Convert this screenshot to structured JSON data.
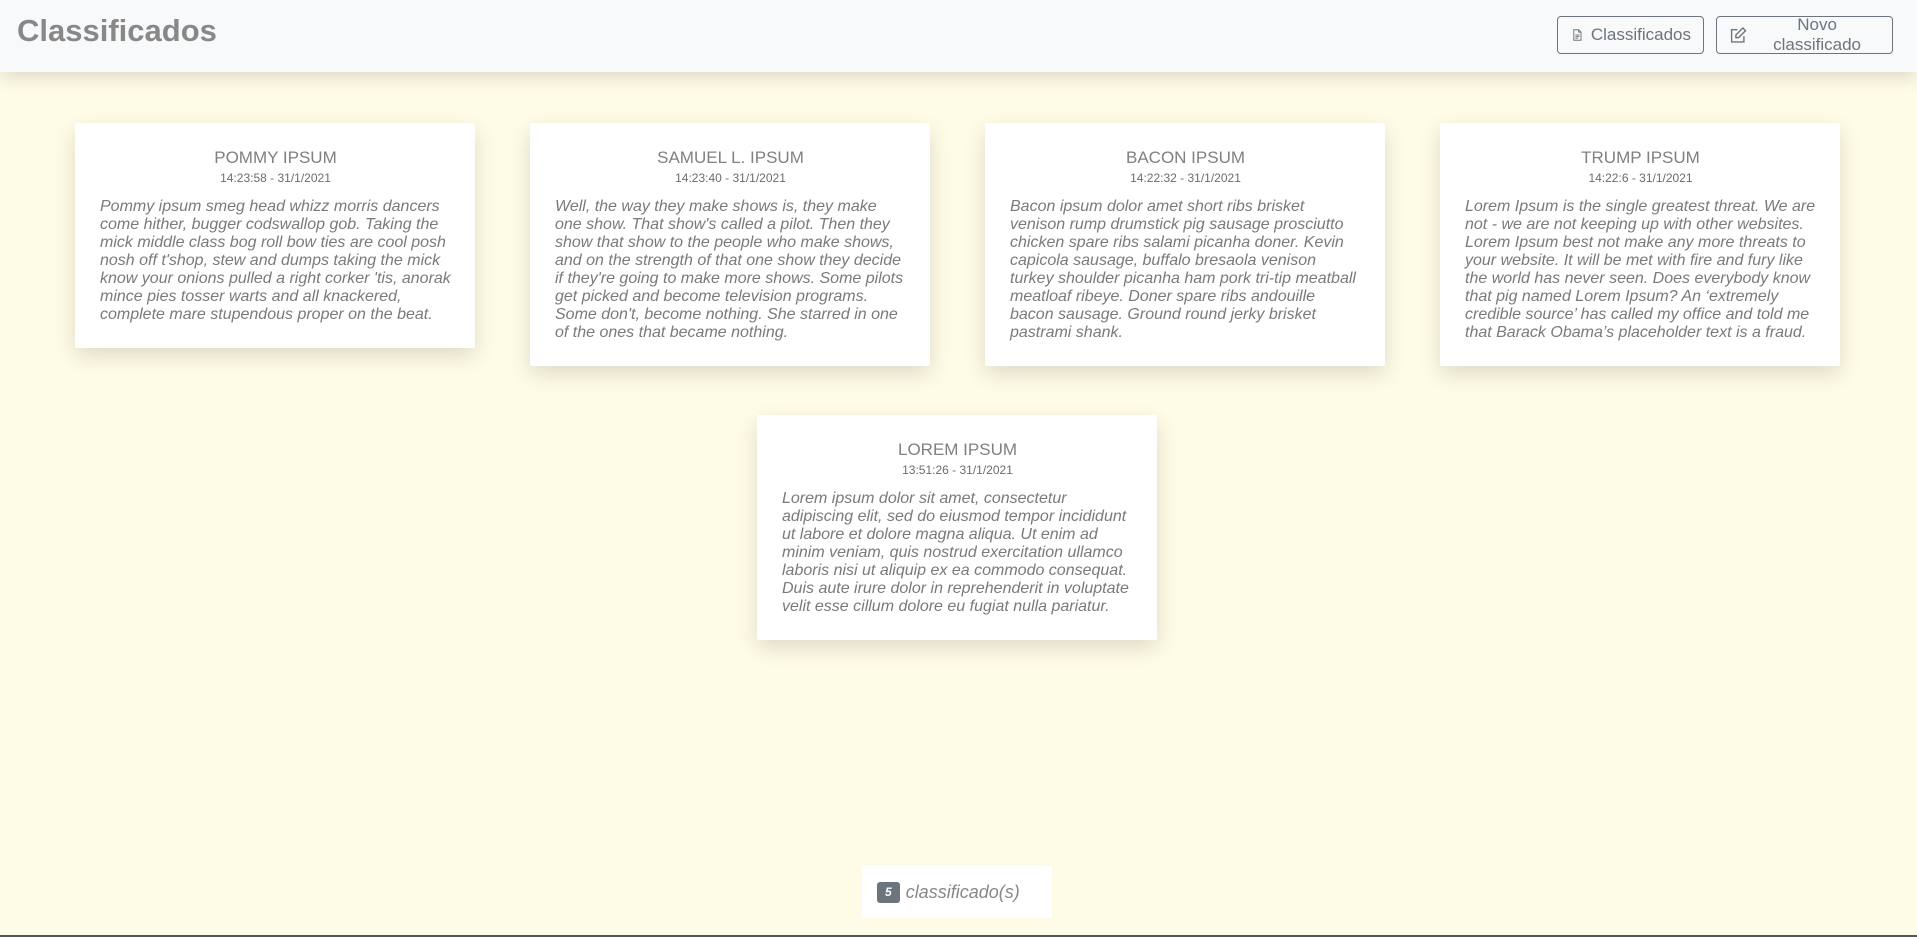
{
  "app": {
    "brand": "Classificados"
  },
  "nav": {
    "list_label": "Classificados",
    "new_label": "Novo classificado"
  },
  "cards": [
    {
      "title": "POMMY IPSUM",
      "time": "14:23:58 - 31/1/2021",
      "text": "Pommy ipsum smeg head whizz morris dancers come hither, bugger codswallop gob. Taking the mick middle class bog roll bow ties are cool posh nosh off t'shop, stew and dumps taking the mick know your onions pulled a right corker 'tis, anorak mince pies tosser warts and all knackered, complete mare stupendous proper on the beat."
    },
    {
      "title": "SAMUEL L. IPSUM",
      "time": "14:23:40 - 31/1/2021",
      "text": "Well, the way they make shows is, they make one show. That show's called a pilot. Then they show that show to the people who make shows, and on the strength of that one show they decide if they're going to make more shows. Some pilots get picked and become television programs. Some don't, become nothing. She starred in one of the ones that became nothing."
    },
    {
      "title": "BACON IPSUM",
      "time": "14:22:32 - 31/1/2021",
      "text": "Bacon ipsum dolor amet short ribs brisket venison rump drumstick pig sausage prosciutto chicken spare ribs salami picanha doner. Kevin capicola sausage, buffalo bresaola venison turkey shoulder picanha ham pork tri-tip meatball meatloaf ribeye. Doner spare ribs andouille bacon sausage. Ground round jerky brisket pastrami shank."
    },
    {
      "title": "TRUMP IPSUM",
      "time": "14:22:6 - 31/1/2021",
      "text": "Lorem Ipsum is the single greatest threat. We are not - we are not keeping up with other websites. Lorem Ipsum best not make any more threats to your website. It will be met with fire and fury like the world has never seen. Does everybody know that pig named Lorem Ipsum? An ‘extremely credible source’ has called my office and told me that Barack Obama’s placeholder text is a fraud."
    },
    {
      "title": "LOREM IPSUM",
      "time": "13:51:26 - 31/1/2021",
      "text": "Lorem ipsum dolor sit amet, consectetur adipiscing elit, sed do eiusmod tempor incididunt ut labore et dolore magna aliqua. Ut enim ad minim veniam, quis nostrud exercitation ullamco laboris nisi ut aliquip ex ea commodo consequat. Duis aute irure dolor in reprehenderit in voluptate velit esse cillum dolore eu fugiat nulla pariatur."
    }
  ],
  "footer": {
    "count": "5",
    "count_label": "classificado(s)"
  },
  "icons": {
    "list": "file-text-icon",
    "new": "edit-icon"
  },
  "colors": {
    "background": "#fefbe6",
    "header": "#f8f9fa",
    "button_border": "#6c757d",
    "badge": "#6c757d"
  }
}
